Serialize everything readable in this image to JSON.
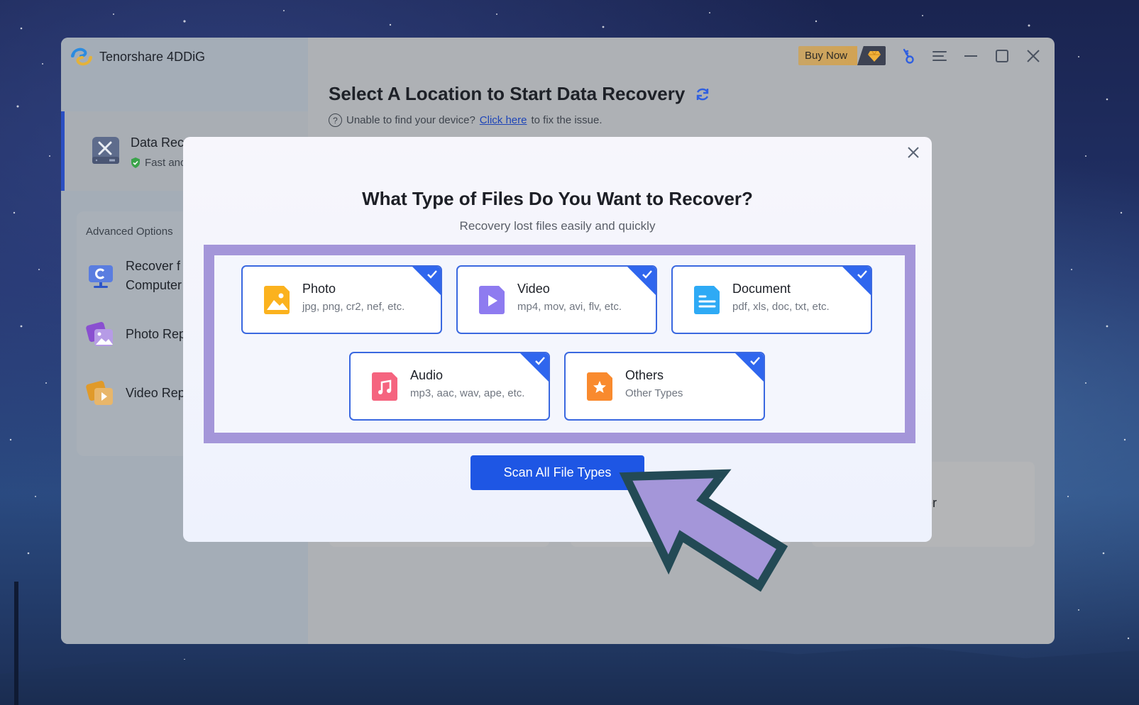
{
  "app": {
    "title": "Tenorshare 4DDiG",
    "buy_now_label": "Buy Now",
    "window_controls": [
      "key-icon",
      "menu-icon",
      "minimize-icon",
      "maximize-icon",
      "close-icon"
    ]
  },
  "sidebar": {
    "active_item": {
      "label": "Data Recc",
      "subtitle": "Fast anc",
      "icon": "drive-tools-icon",
      "badge_icon": "shield-check-icon"
    },
    "advanced_options_title": "Advanced Options",
    "advanced_items": [
      {
        "label_line1": "Recover f",
        "label_line2": "Computer",
        "icon": "computer-recover-icon"
      },
      {
        "label_line1": "Photo Rep",
        "icon": "photo-repair-icon"
      },
      {
        "label_line1": "Video Rep",
        "icon": "video-repair-icon"
      }
    ]
  },
  "main": {
    "title": "Select A Location to Start Data Recovery",
    "refresh_icon": "refresh-icon",
    "help_prefix": "Unable to find your device?",
    "help_link": "Click here",
    "help_suffix": "to fix the issue.",
    "background_card_partial_label": "der"
  },
  "modal": {
    "title": "What Type of Files Do You Want to Recover?",
    "subtitle": "Recovery lost files easily and quickly",
    "file_types": [
      {
        "name": "Photo",
        "desc": "jpg, png, cr2, nef, etc.",
        "checked": true,
        "color": "#fbb21e",
        "icon": "photo-file-icon"
      },
      {
        "name": "Video",
        "desc": "mp4, mov, avi, flv, etc.",
        "checked": true,
        "color": "#8e7bf0",
        "icon": "video-file-icon"
      },
      {
        "name": "Document",
        "desc": "pdf, xls, doc, txt, etc.",
        "checked": true,
        "color": "#2eaaf5",
        "icon": "document-file-icon"
      },
      {
        "name": "Audio",
        "desc": "mp3, aac, wav, ape, etc.",
        "checked": true,
        "color": "#f5647f",
        "icon": "audio-file-icon"
      },
      {
        "name": "Others",
        "desc": "Other Types",
        "checked": true,
        "color": "#f98a2e",
        "icon": "other-file-icon"
      }
    ],
    "scan_button_label": "Scan All File Types"
  },
  "colors": {
    "accent": "#1e56e4",
    "highlight": "#a496d9",
    "arrow_fill": "#a496d9",
    "arrow_stroke": "#234a55"
  }
}
